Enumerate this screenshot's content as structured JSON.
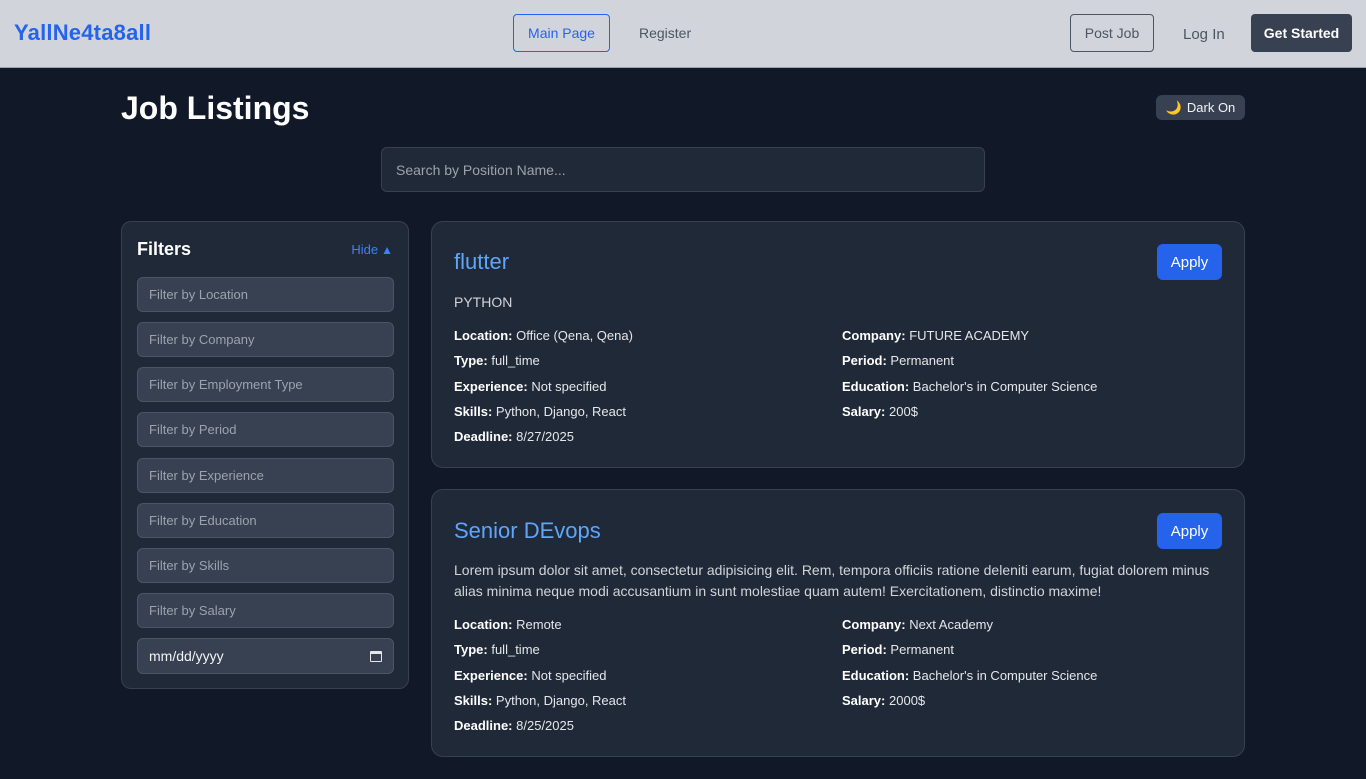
{
  "navbar": {
    "brand": "YallNe4ta8all",
    "main_page": "Main Page",
    "register": "Register",
    "post_job": "Post Job",
    "log_in": "Log In",
    "get_started": "Get Started"
  },
  "header": {
    "title": "Job Listings",
    "dark_toggle_icon": "moon-icon",
    "dark_toggle_label": "Dark On"
  },
  "search": {
    "placeholder": "Search by Position Name..."
  },
  "filters": {
    "title": "Filters",
    "hide_label": "Hide",
    "hide_icon": "triangle-up-icon",
    "inputs": [
      "Filter by Location",
      "Filter by Company",
      "Filter by Employment Type",
      "Filter by Period",
      "Filter by Experience",
      "Filter by Education",
      "Filter by Skills",
      "Filter by Salary"
    ],
    "date_placeholder": "mm/dd/yyyy"
  },
  "jobs": [
    {
      "title": "flutter",
      "apply": "Apply",
      "description": "PYTHON",
      "details": {
        "location_label": "Location:",
        "location": "Office (Qena, Qena)",
        "company_label": "Company:",
        "company": "FUTURE ACADEMY",
        "type_label": "Type:",
        "type": "full_time",
        "period_label": "Period:",
        "period": "Permanent",
        "experience_label": "Experience:",
        "experience": "Not specified",
        "education_label": "Education:",
        "education": "Bachelor's in Computer Science",
        "skills_label": "Skills:",
        "skills": "Python, Django, React",
        "salary_label": "Salary:",
        "salary": "200$",
        "deadline_label": "Deadline:",
        "deadline": "8/27/2025"
      }
    },
    {
      "title": "Senior DEvops",
      "apply": "Apply",
      "description": "Lorem ipsum dolor sit amet, consectetur adipisicing elit. Rem, tempora officiis ratione deleniti earum, fugiat dolorem minus alias minima neque modi accusantium in sunt molestiae quam autem! Exercitationem, distinctio maxime!",
      "details": {
        "location_label": "Location:",
        "location": "Remote",
        "company_label": "Company:",
        "company": "Next Academy",
        "type_label": "Type:",
        "type": "full_time",
        "period_label": "Period:",
        "period": "Permanent",
        "experience_label": "Experience:",
        "experience": "Not specified",
        "education_label": "Education:",
        "education": "Bachelor's in Computer Science",
        "skills_label": "Skills:",
        "skills": "Python, Django, React",
        "salary_label": "Salary:",
        "salary": "2000$",
        "deadline_label": "Deadline:",
        "deadline": "8/25/2025"
      }
    }
  ],
  "colors": {
    "background": "#111827",
    "card": "#1f2937",
    "accent": "#2563eb",
    "title_link": "#60a5fa",
    "navbar": "#d1d5db"
  }
}
